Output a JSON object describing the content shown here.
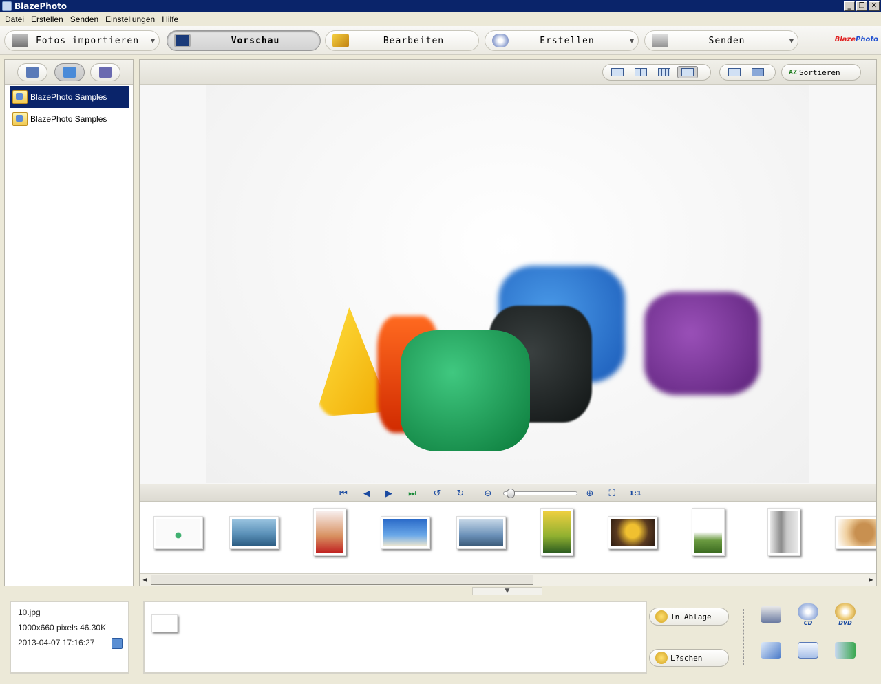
{
  "window": {
    "title": "BlazePhoto"
  },
  "menu": [
    "Datei",
    "Erstellen",
    "Senden",
    "Einstellungen",
    "Hilfe"
  ],
  "toolbar": {
    "import_label": "Fotos importieren",
    "preview_label": "Vorschau",
    "edit_label": "Bearbeiten",
    "create_label": "Erstellen",
    "send_label": "Senden",
    "brand_a": "Blaze",
    "brand_b": "Photo"
  },
  "folders": [
    {
      "label": "BlazePhoto Samples",
      "selected": true
    },
    {
      "label": "BlazePhoto Samples",
      "selected": false
    }
  ],
  "viewer": {
    "sort_label": "Sortieren",
    "zoom_level": 0.05
  },
  "info": {
    "filename": "10.jpg",
    "dimensions": "1000x660 pixels  46.30K",
    "datetime": "2013-04-07 17:16:27"
  },
  "tray": {
    "lock_label": "In Ablage",
    "delete_label": "L?schen"
  },
  "output": {
    "cd_label": "CD",
    "dvd_label": "DVD"
  },
  "icons": [
    "camera-icon",
    "preview-icon",
    "brush-icon",
    "disc-icon",
    "printer-icon",
    "lock-icon",
    "delete-icon",
    "email-icon",
    "export-icon"
  ]
}
